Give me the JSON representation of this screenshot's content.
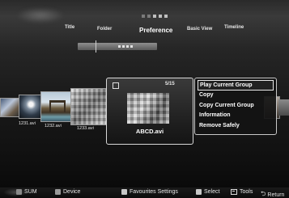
{
  "header": {
    "tabs": [
      {
        "label": "Title",
        "active": false
      },
      {
        "label": "Folder",
        "active": false
      },
      {
        "label": "Preference",
        "active": true
      },
      {
        "label": "Basic View",
        "active": false
      },
      {
        "label": "Timeline",
        "active": false
      }
    ]
  },
  "thumbnails": [
    {
      "label": "1231.avi"
    },
    {
      "label": "1232.avi"
    },
    {
      "label": "1233.avi"
    }
  ],
  "focused_item": {
    "counter": "5/15",
    "name": "ABCD.avi"
  },
  "context_menu": {
    "items": [
      {
        "label": "Play Current Group",
        "selected": true
      },
      {
        "label": "Copy",
        "selected": false
      },
      {
        "label": "Copy Current Group",
        "selected": false
      },
      {
        "label": "Information",
        "selected": false
      },
      {
        "label": "Remove Safely",
        "selected": false
      }
    ]
  },
  "footer": {
    "sum_label": "SUM",
    "device_label": "Device",
    "favourites_label": "Favourites Settings",
    "select_label": "Select",
    "tools_label": "Tools",
    "return_label": "Return"
  }
}
